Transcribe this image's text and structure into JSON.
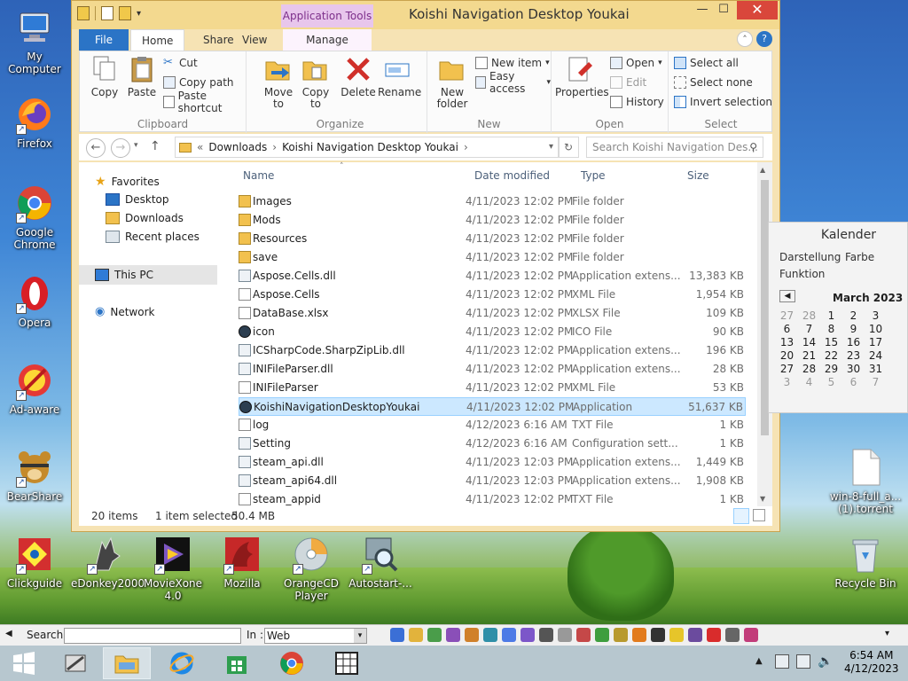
{
  "desktop": {
    "icons": [
      {
        "label": "My Computer"
      },
      {
        "label": "Firefox"
      },
      {
        "label": "Google Chrome"
      },
      {
        "label": "Opera"
      },
      {
        "label": "Ad-aware"
      },
      {
        "label": "BearShare"
      },
      {
        "label": "Clickguide"
      },
      {
        "label": "eDonkey2000"
      },
      {
        "label": "MovieXone 4.0"
      },
      {
        "label": "Mozilla"
      },
      {
        "label": "OrangeCD Player"
      },
      {
        "label": "Autostart-..."
      },
      {
        "label": "win-8-full_a... (1).torrent"
      },
      {
        "label": "Recycle Bin"
      }
    ]
  },
  "explorer": {
    "title": "Koishi Navigation Desktop Youkai",
    "context_tab_header": "Application Tools",
    "tabs": {
      "file": "File",
      "home": "Home",
      "share": "Share",
      "view": "View",
      "manage": "Manage"
    },
    "ribbon": {
      "clipboard": {
        "label": "Clipboard",
        "copy": "Copy",
        "paste": "Paste",
        "cut": "Cut",
        "copy_path": "Copy path",
        "paste_shortcut": "Paste shortcut"
      },
      "organize": {
        "label": "Organize",
        "move_to": "Move to",
        "copy_to": "Copy to",
        "delete": "Delete",
        "rename": "Rename"
      },
      "new": {
        "label": "New",
        "new_folder": "New folder",
        "new_item": "New item",
        "easy_access": "Easy access"
      },
      "open": {
        "label": "Open",
        "properties": "Properties",
        "open": "Open",
        "edit": "Edit",
        "history": "History"
      },
      "select": {
        "label": "Select",
        "select_all": "Select all",
        "select_none": "Select none",
        "invert_selection": "Invert selection"
      }
    },
    "address": {
      "root": "Downloads",
      "current": "Koishi Navigation Desktop Youkai"
    },
    "search_placeholder": "Search Koishi Navigation Des...",
    "nav": {
      "favorites": "Favorites",
      "desktop": "Desktop",
      "downloads": "Downloads",
      "recent": "Recent places",
      "this_pc": "This PC",
      "network": "Network"
    },
    "columns": {
      "name": "Name",
      "date": "Date modified",
      "type": "Type",
      "size": "Size"
    },
    "files": [
      {
        "name": "Images",
        "date": "4/11/2023 12:02 PM",
        "type": "File folder",
        "size": "",
        "icon": "folder-icon"
      },
      {
        "name": "Mods",
        "date": "4/11/2023 12:02 PM",
        "type": "File folder",
        "size": "",
        "icon": "folder-icon"
      },
      {
        "name": "Resources",
        "date": "4/11/2023 12:02 PM",
        "type": "File folder",
        "size": "",
        "icon": "folder-icon"
      },
      {
        "name": "save",
        "date": "4/11/2023 12:02 PM",
        "type": "File folder",
        "size": "",
        "icon": "folder-icon"
      },
      {
        "name": "Aspose.Cells.dll",
        "date": "4/11/2023 12:02 PM",
        "type": "Application extens...",
        "size": "13,383 KB",
        "icon": "dll-icon"
      },
      {
        "name": "Aspose.Cells",
        "date": "4/11/2023 12:02 PM",
        "type": "XML File",
        "size": "1,954 KB",
        "icon": "file-icon"
      },
      {
        "name": "DataBase.xlsx",
        "date": "4/11/2023 12:02 PM",
        "type": "XLSX File",
        "size": "109 KB",
        "icon": "file-icon"
      },
      {
        "name": "icon",
        "date": "4/11/2023 12:02 PM",
        "type": "ICO File",
        "size": "90 KB",
        "icon": "ico-icon"
      },
      {
        "name": "ICSharpCode.SharpZipLib.dll",
        "date": "4/11/2023 12:02 PM",
        "type": "Application extens...",
        "size": "196 KB",
        "icon": "dll-icon"
      },
      {
        "name": "INIFileParser.dll",
        "date": "4/11/2023 12:02 PM",
        "type": "Application extens...",
        "size": "28 KB",
        "icon": "dll-icon"
      },
      {
        "name": "INIFileParser",
        "date": "4/11/2023 12:02 PM",
        "type": "XML File",
        "size": "53 KB",
        "icon": "file-icon"
      },
      {
        "name": "KoishiNavigationDesktopYoukai",
        "date": "4/11/2023 12:02 PM",
        "type": "Application",
        "size": "51,637 KB",
        "icon": "ico-icon"
      },
      {
        "name": "log",
        "date": "4/12/2023 6:16 AM",
        "type": "TXT File",
        "size": "1 KB",
        "icon": "file-icon"
      },
      {
        "name": "Setting",
        "date": "4/12/2023 6:16 AM",
        "type": "Configuration sett...",
        "size": "1 KB",
        "icon": "dll-icon"
      },
      {
        "name": "steam_api.dll",
        "date": "4/11/2023 12:03 PM",
        "type": "Application extens...",
        "size": "1,449 KB",
        "icon": "dll-icon"
      },
      {
        "name": "steam_api64.dll",
        "date": "4/11/2023 12:03 PM",
        "type": "Application extens...",
        "size": "1,908 KB",
        "icon": "dll-icon"
      },
      {
        "name": "steam_appid",
        "date": "4/11/2023 12:02 PM",
        "type": "TXT File",
        "size": "1 KB",
        "icon": "file-icon"
      }
    ],
    "status": {
      "count": "20 items",
      "selected": "1 item selected",
      "size": "50.4 MB"
    }
  },
  "kalender": {
    "title": "Kalender",
    "menu": {
      "darstellung": "Darstellung",
      "farbe": "Farbe",
      "funktion": "Funktion"
    },
    "month": "March 2023",
    "rows": [
      [
        "27",
        "28",
        "1",
        "2",
        "3"
      ],
      [
        "6",
        "7",
        "8",
        "9",
        "10"
      ],
      [
        "13",
        "14",
        "15",
        "16",
        "17"
      ],
      [
        "20",
        "21",
        "22",
        "23",
        "24"
      ],
      [
        "27",
        "28",
        "29",
        "30",
        "31"
      ],
      [
        "3",
        "4",
        "5",
        "6",
        "7"
      ]
    ]
  },
  "toolbar": {
    "search_label": "Search :",
    "in_label": "In :",
    "in_value": "Web"
  },
  "taskbar": {
    "time": "6:54 AM",
    "date": "4/12/2023"
  }
}
